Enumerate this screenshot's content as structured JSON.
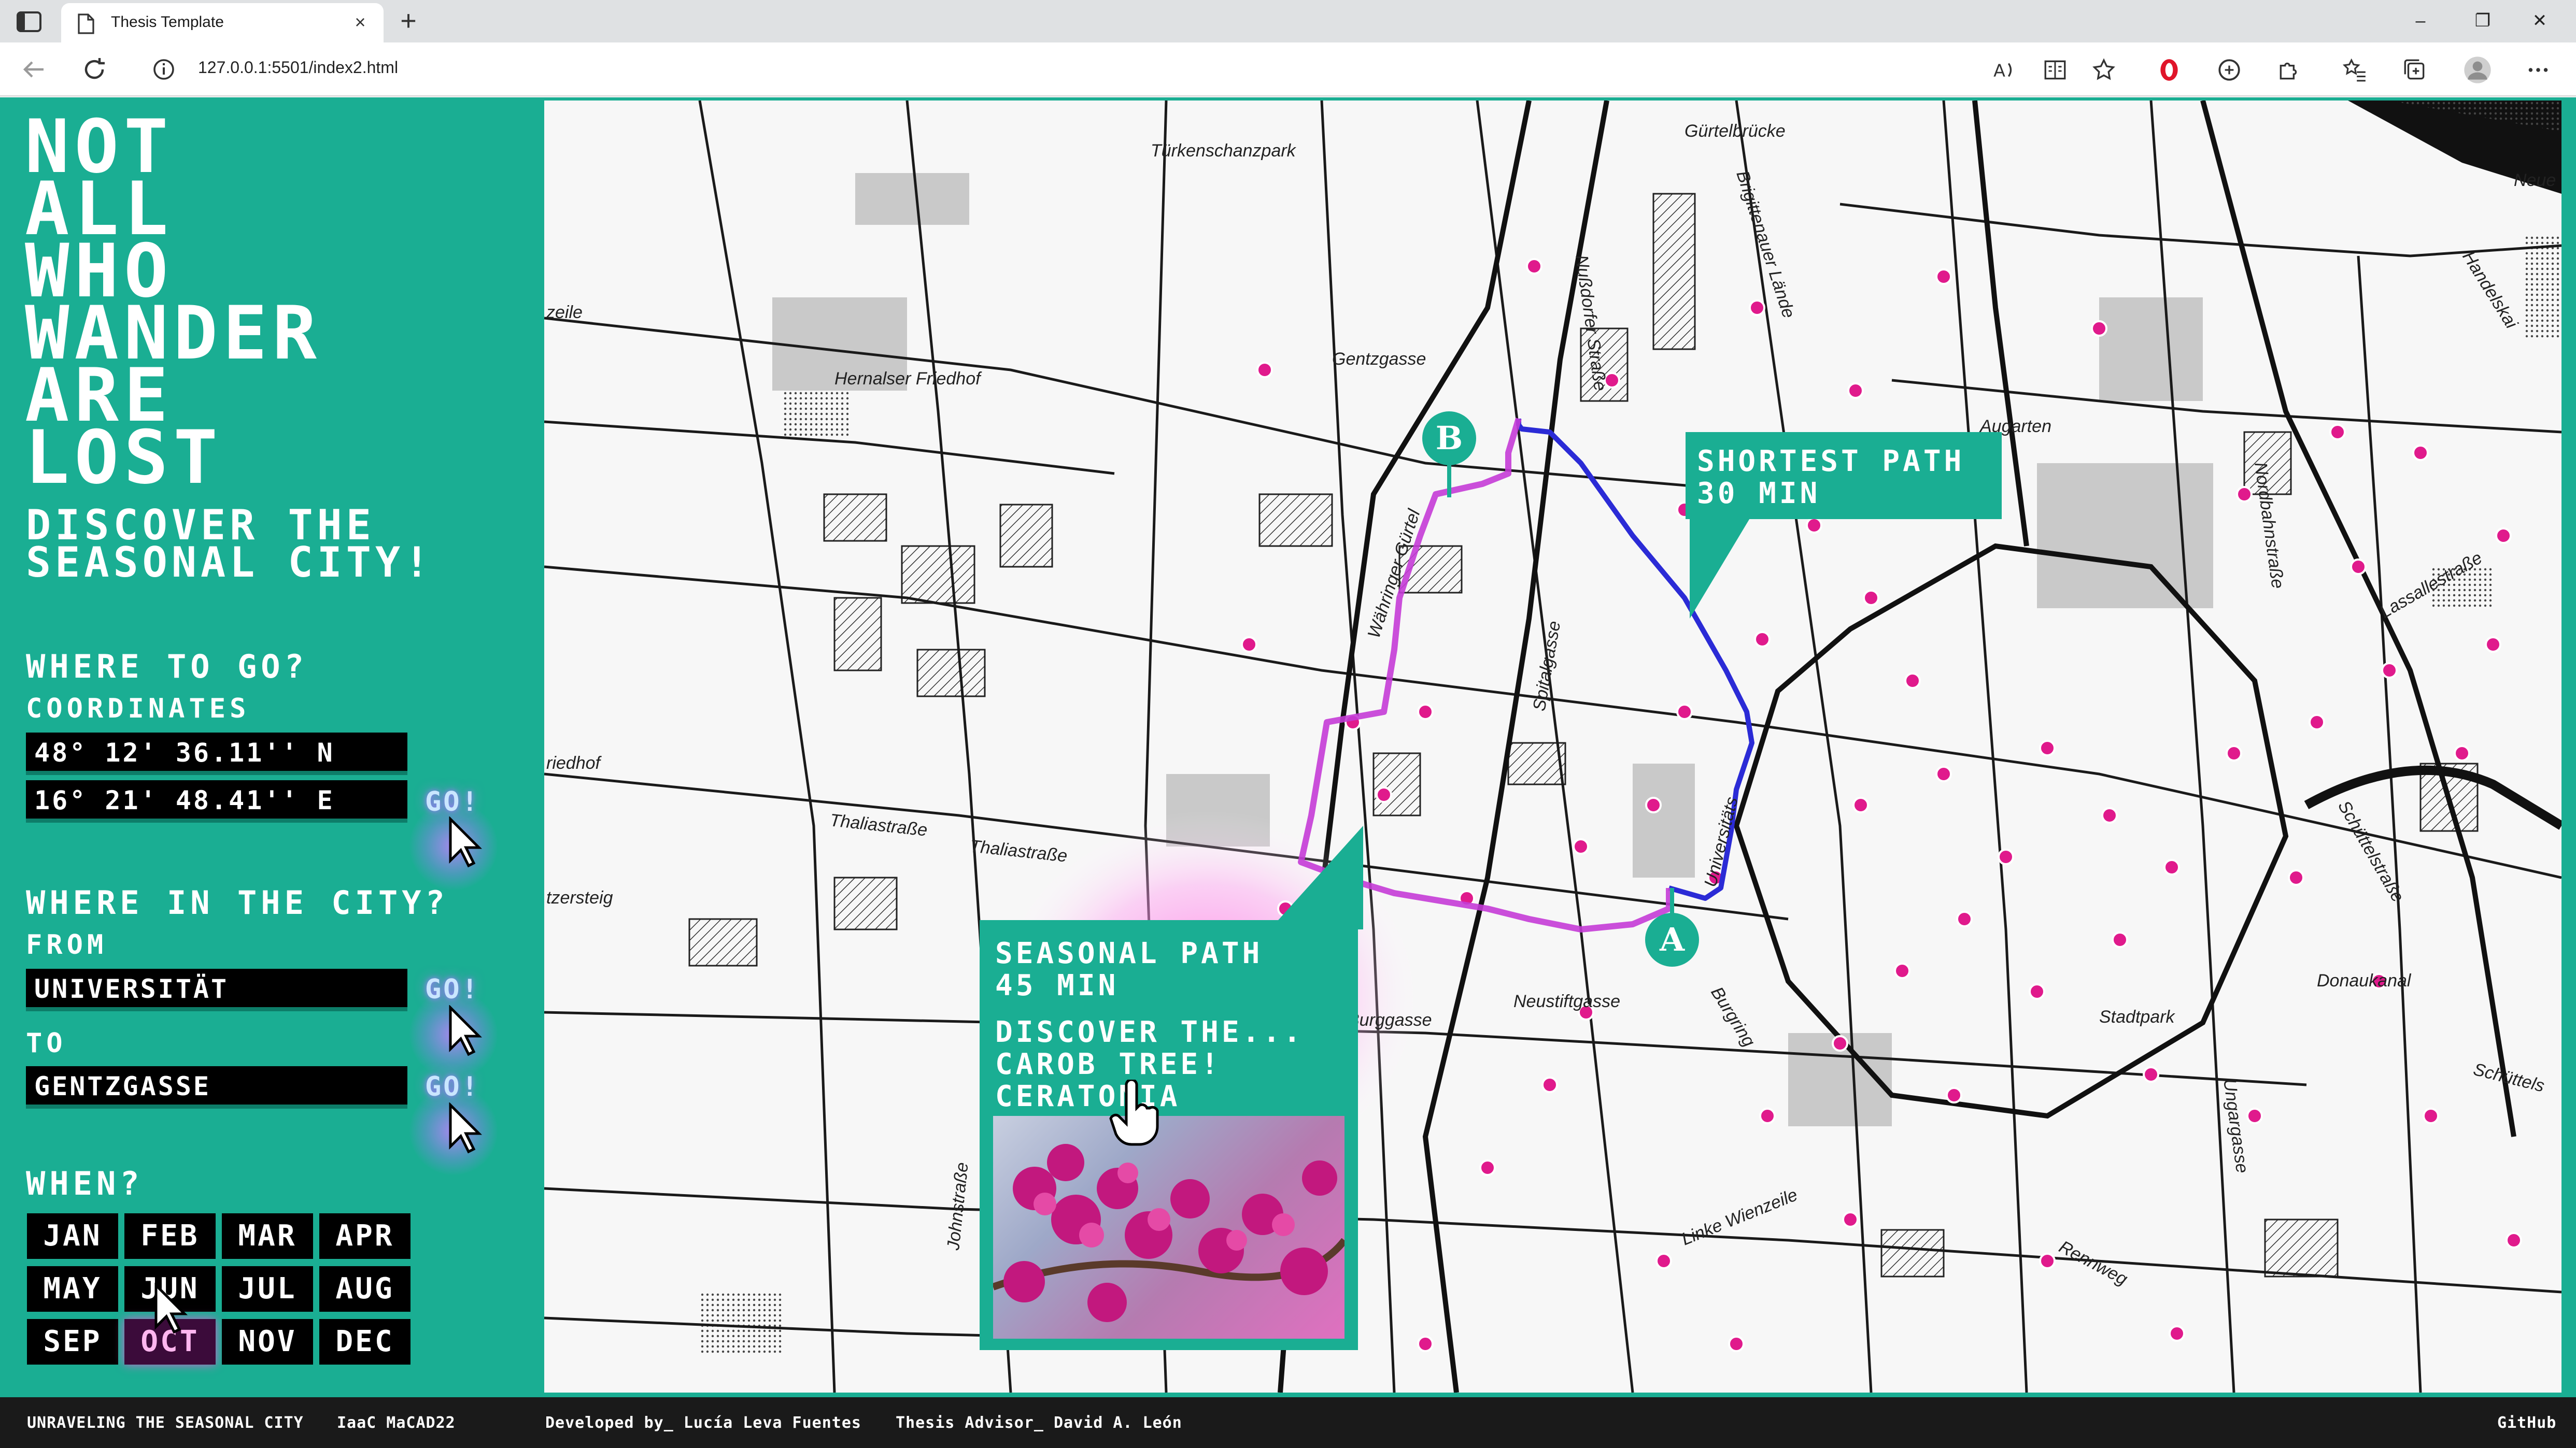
{
  "browser": {
    "tab_title": "Thesis Template",
    "tab_close": "×",
    "new_tab": "+",
    "url": "127.0.0.1:5501/index2.html",
    "minimize": "–",
    "restore": "❐",
    "close": "✕"
  },
  "sidebar": {
    "title_lines": [
      "NOT",
      "ALL",
      "WHO",
      "WANDER",
      "ARE",
      "LOST"
    ],
    "subtitle_lines": [
      "DISCOVER THE",
      "SEASONAL CITY!"
    ],
    "where_to_go": "WHERE TO GO?",
    "coordinates_label": "COORDINATES",
    "latitude": "48° 12' 36.11'' N",
    "longitude": "16° 21' 48.41'' E",
    "go_label": "GO!",
    "where_in_city": "WHERE IN THE CITY?",
    "from_label": "FROM",
    "from_value": "UNIVERSITÄT",
    "to_label": "TO",
    "to_value": "GENTZGASSE",
    "when_label": "WHEN?",
    "months": [
      "JAN",
      "FEB",
      "MAR",
      "APR",
      "MAY",
      "JUN",
      "JUL",
      "AUG",
      "SEP",
      "OCT",
      "NOV",
      "DEC"
    ],
    "selected_month": "OCT",
    "hovered_month": "JUN"
  },
  "map": {
    "shortest_path": [
      "SHORTEST PATH",
      "30 MIN"
    ],
    "seasonal_path": [
      "SEASONAL PATH",
      "45 MIN"
    ],
    "discover_lines": [
      "DISCOVER THE...",
      "CAROB TREE!",
      "CERATONIA SILIQUA"
    ],
    "pin_a": "A",
    "pin_b": "B",
    "labels": {
      "turkenschanzpark": "Türkenschanzpark",
      "gurtelbrucke": "Gürtelbrücke",
      "hernalser": "Hernalser Friedhof",
      "gentzgasse": "Gentzgasse",
      "nussdorfer": "Nußdorfer Straße",
      "brigittenauer": "Brigittenauer Lände",
      "augarten": "Augarten",
      "wahringer": "Währinger Gürtel",
      "spitalgasse": "Spitalgasse",
      "universitats": "Universitäts",
      "thaliastrasse1": "Thaliastraße",
      "thaliastrasse2": "Thaliastraße",
      "neustiftgasse": "Neustiftgasse",
      "burggasse": "Burggasse",
      "burgring": "Burgring",
      "linke_wienzeile": "Linke Wienzeile",
      "stadtpark": "Stadtpark",
      "donaukanal": "Donaukanal",
      "handelskai": "Handelskai",
      "lassallestrasse": "Lassallestraße",
      "nordbahnstrasse": "Nordbahnstraße",
      "schuttelstr": "Schüttelstraße",
      "schuttels": "Schüttels",
      "ungargasse": "Ungargasse",
      "rennweg": "Rennweg",
      "zeile": "zeile",
      "friedhof": "riedhof",
      "zersteig": "tzersteig",
      "neue": "Neue",
      "johnstrasse": "Johnstraße"
    },
    "colors": {
      "accent": "#1aae93",
      "shortest_path": "#2b2bd6",
      "seasonal_path": "#c43bd6",
      "poi": "#e01a8c"
    }
  },
  "footer": {
    "project": "UNRAVELING THE SEASONAL CITY",
    "school": "IaaC MaCAD22",
    "developed": "Developed by_ Lucía Leva Fuentes",
    "advisor": "Thesis Advisor_ David A. León",
    "github": "GitHub"
  },
  "icons": [
    "window-menu-icon",
    "page-icon",
    "back-icon",
    "reload-icon",
    "info-icon",
    "read-aloud-icon",
    "reader-icon",
    "favorite-icon",
    "opera-icon",
    "extension-icon",
    "puzzle-icon",
    "favorites-icon",
    "collections-icon",
    "profile-icon",
    "more-icon",
    "cursor-icon"
  ]
}
